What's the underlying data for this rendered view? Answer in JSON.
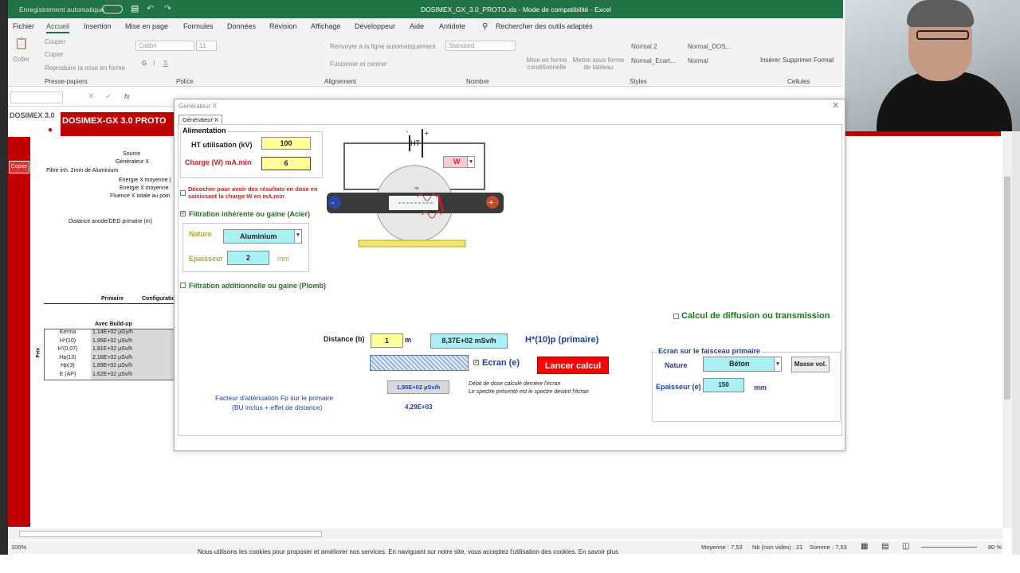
{
  "window": {
    "title": "DOSIMEX_GX_3.0_PROTO.xls  -  Mode de compatibilité  -  Excel",
    "autosave": "Enregistrement automatique"
  },
  "tabs": [
    "Fichier",
    "Accueil",
    "Insertion",
    "Mise en page",
    "Formules",
    "Données",
    "Révision",
    "Affichage",
    "Développeur",
    "Aide",
    "Antidote"
  ],
  "search_placeholder": "Rechercher des outils adaptés",
  "ribbon": {
    "clipboard": {
      "paste": "Coller",
      "cut": "Couper",
      "copy": "Copier",
      "format_painter": "Reproduire la mise en forme",
      "label": "Presse-papiers"
    },
    "font": {
      "name": "Calibri",
      "size": "11",
      "label": "Police",
      "bold": "G",
      "italic": "I",
      "underline": "S"
    },
    "alignment": {
      "wrap": "Renvoyer à la ligne automatiquement",
      "merge": "Fusionner et centrer",
      "label": "Alignement"
    },
    "number": {
      "format": "Standard",
      "label": "Nombre"
    },
    "styles": {
      "cond": "Mise en forme conditionnelle",
      "table": "Mettre sous forme de tableau",
      "s1": "Normal 2",
      "s2": "Normal_DOS...",
      "s3": "Normal_Ecart...",
      "s4": "Normal",
      "label": "Styles"
    },
    "cells": {
      "insert": "Insérer",
      "delete": "Supprimer",
      "format": "Format",
      "label": "Cellules"
    }
  },
  "sheet": {
    "logo": "DOSIMEX 3.0",
    "app_name": "DOSIMEX-GX 3.0 PROTO",
    "copier": "Copier",
    "labels": [
      "Source",
      "Générateur X",
      "Filtre inh. 2mm de Aluminium",
      "Energie X moyenne (",
      "Energie X moyenne",
      "Fluence X totale au poin",
      "Distance anode/DED primaire (m)",
      "Primaire",
      "Configuratio",
      "Avec Build-up",
      "Pein"
    ],
    "table": [
      {
        "k": "Kerma",
        "v": "1,14E+02 µGy/h"
      },
      {
        "k": "H*(10)",
        "v": "1,95E+02 µSv/h"
      },
      {
        "k": "H'(0,07)",
        "v": "1,81E+02 µSv/h"
      },
      {
        "k": "Hp(10)",
        "v": "2,16E+02 µSv/h"
      },
      {
        "k": "Hp(3)",
        "v": "1,89E+02 µSv/h"
      },
      {
        "k": "E (AP)",
        "v": "1,62E+02 µSv/h"
      }
    ]
  },
  "status": {
    "zoom_left": "100%",
    "moyenne": "Moyenne : 7,53",
    "nb": "Nb (non vides) : 21",
    "somme": "Somme : 7,53",
    "zoom": "80 %",
    "behind_text": "Nous utilisons les cookies pour proposer et améliorer nos services. En naviguant sur notre site, vous acceptez l'utilisation des cookies. En savoir plus"
  },
  "dialog": {
    "title": "Générateur X",
    "tab": "Générateur X",
    "alimentation": "Alimentation",
    "ht_label": "HT utilisation (kV)",
    "ht_value": "100",
    "charge_label": "Charge (W) mA.min",
    "charge_value": "6",
    "decocher": "Décocher pour avoir des résultats en dose en saisissant la charge W en mA.min",
    "filtration_inh": "Filtration inhérente ou gaine (Acier)",
    "nature_label": "Nature",
    "nature_value": "Aluminium",
    "epaisseur_label": "Epaisseur",
    "epaisseur_value": "2",
    "mm": "mm",
    "filtration_add": "Filtration additionnelle ou gaine (Plomb)",
    "diagram": {
      "ht": "HT",
      "minus": "-",
      "plus": "+",
      "w": "W",
      "dist": "dp"
    },
    "calcul_diffusion": "Calcul de diffusion ou transmission",
    "distance_label": "Distance  (b)",
    "distance_value": "1",
    "m": "m",
    "result_value": "8,37E+02 mSv/h",
    "h10p": "H*(10)p  (primaire)",
    "ecran_chk": "Ecran (e)",
    "lancer": "Lancer calcul",
    "dose_behind": "1,95E+02 µSv/h",
    "debit_note1": "Débit de dose calculé derrière l'écran",
    "debit_note2": "Le spectre présenté est le spectre devant l'écran",
    "facteur1": "Facteur d'atténuation Fp sur le primaire",
    "facteur2": "(BU inclus + effet de distance)",
    "facteur_value": "4,29E+03",
    "ecran_frame": "Ecran sur le faisceau primaire",
    "ecran_nature_label": "Nature",
    "ecran_nature_value": "Béton",
    "masse_vol": "Masse vol.",
    "ecran_ep_label": "Epaisseur (e)",
    "ecran_ep_value": "150",
    "ecran_mm": "mm"
  }
}
